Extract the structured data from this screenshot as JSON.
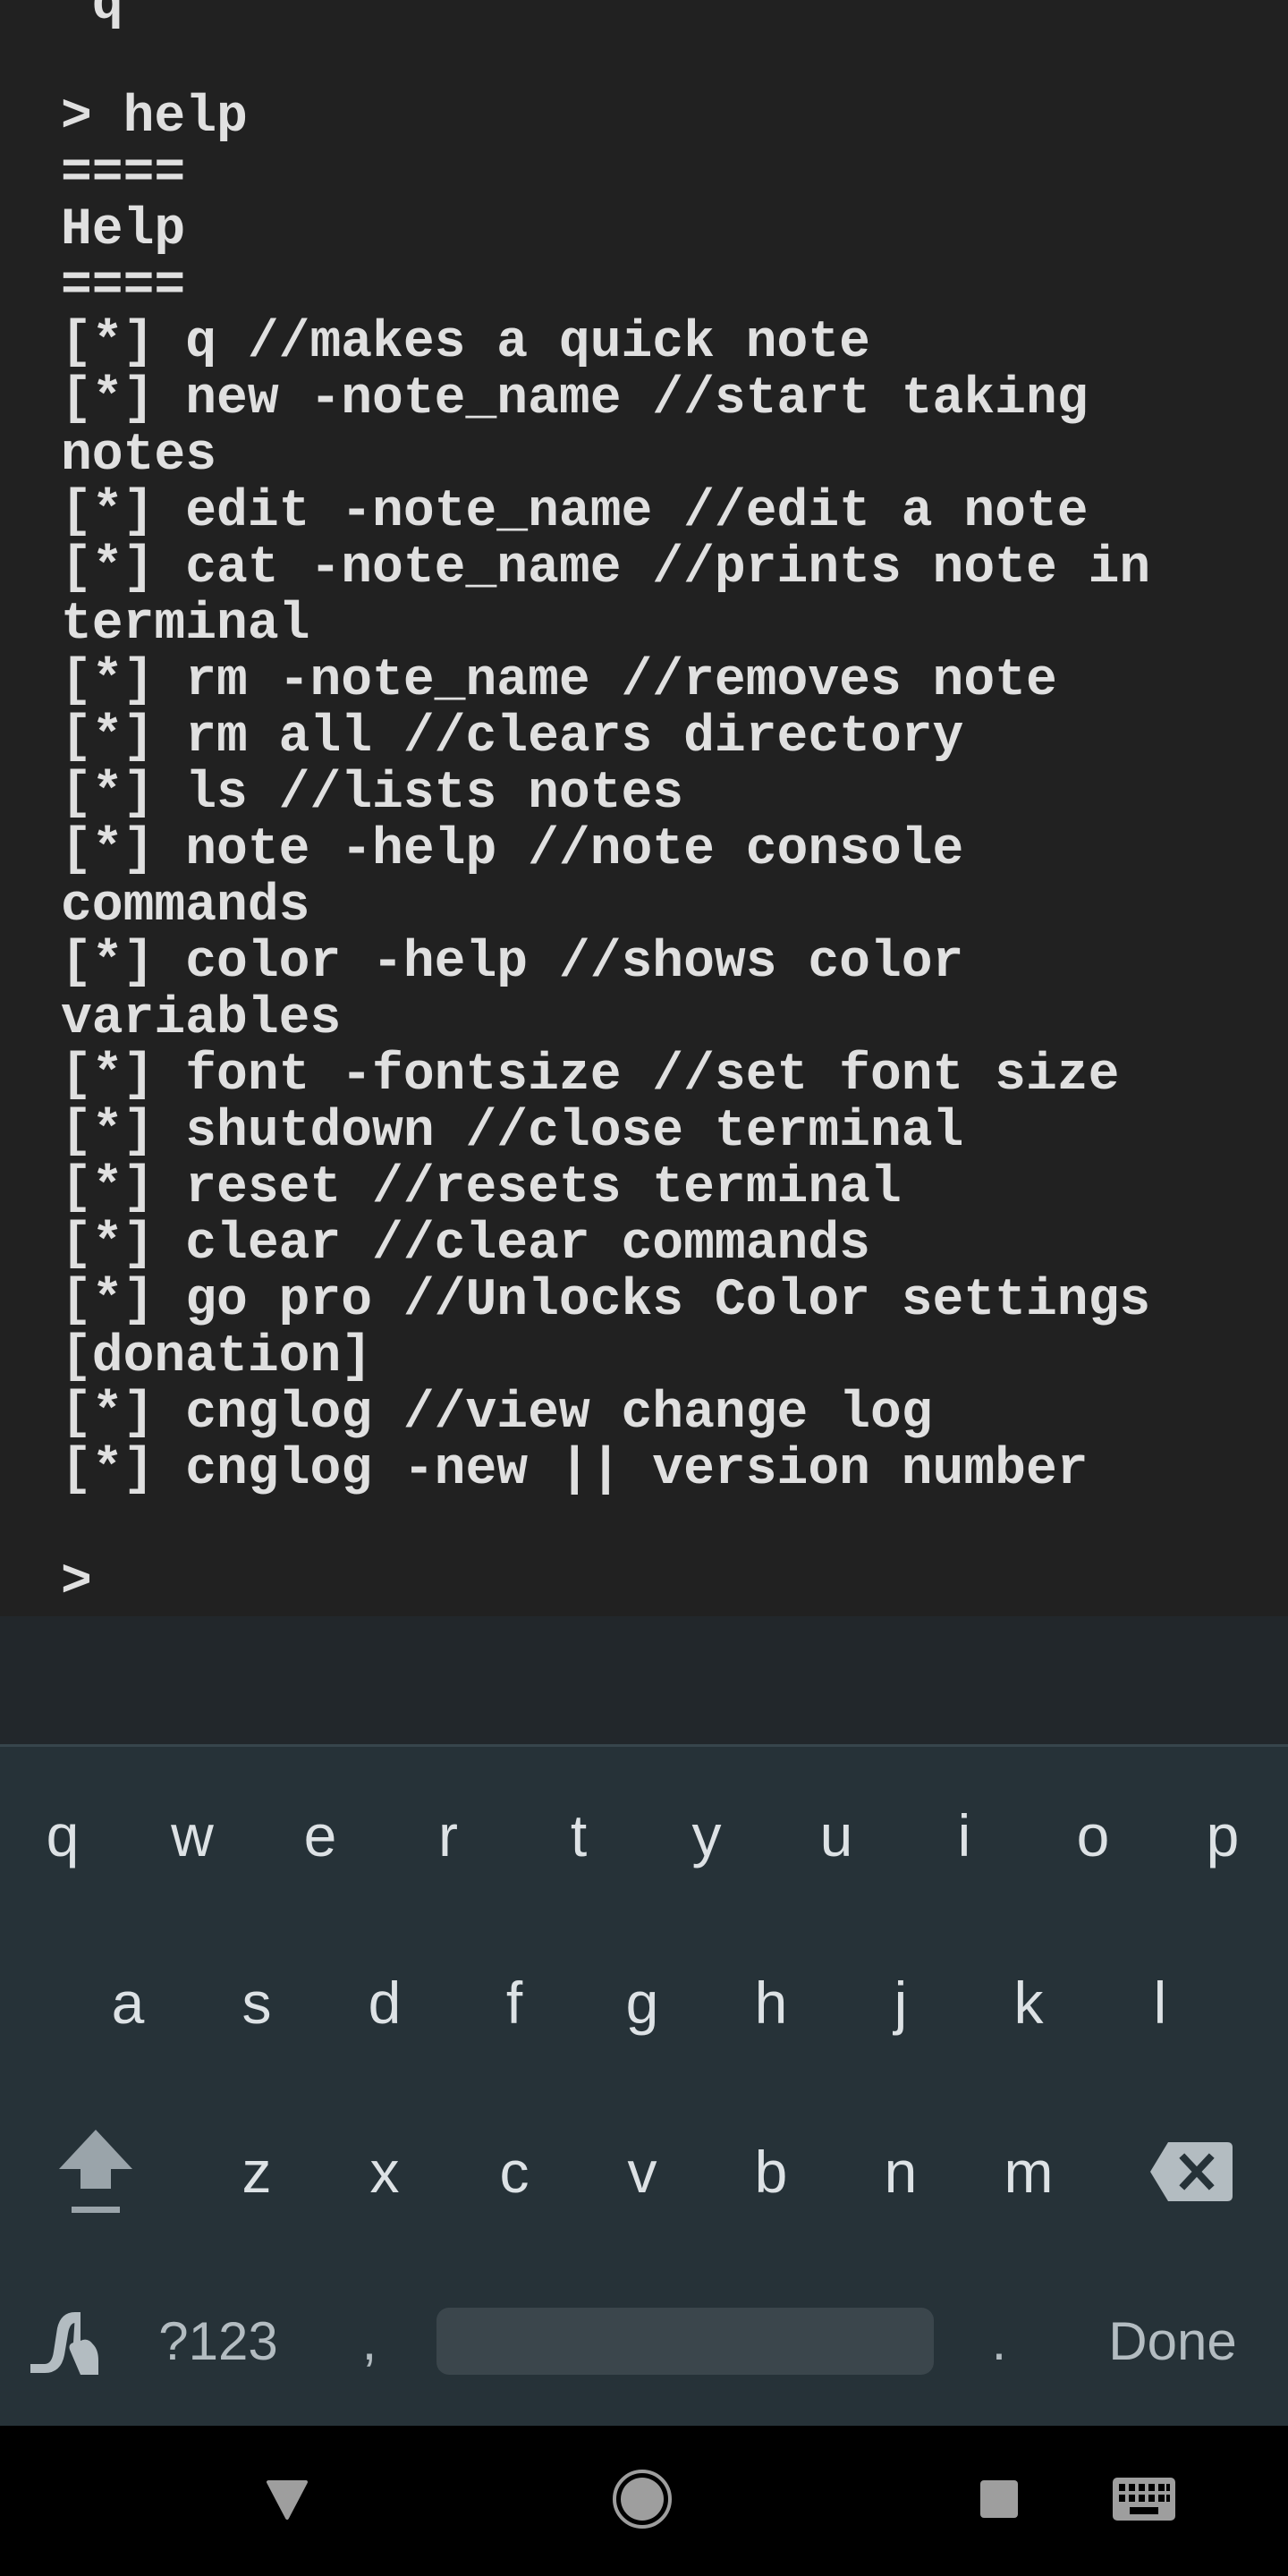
{
  "terminal": {
    "lines": [
      " q",
      "",
      "> help",
      "====",
      "Help",
      "====",
      "[*] q //makes a quick note",
      "[*] new -note_name //start taking",
      "notes",
      "[*] edit -note_name //edit a note",
      "[*] cat -note_name //prints note in",
      "terminal",
      "[*] rm -note_name //removes note",
      "[*] rm all //clears directory",
      "[*] ls //lists notes",
      "[*] note -help //note console",
      "commands",
      "[*] color -help //shows color",
      "variables",
      "[*] font -fontsize //set font size",
      "[*] shutdown //close terminal",
      "[*] reset //resets terminal",
      "[*] clear //clear commands",
      "[*] go pro //Unlocks Color settings",
      "[donation]",
      "[*] cnglog //view change log",
      "[*] cnglog -new || version number",
      "",
      ">"
    ],
    "prompt": ">",
    "colors": {
      "background": "#212121",
      "text": "#e0e0e0"
    }
  },
  "keyboard": {
    "row1": [
      "q",
      "w",
      "e",
      "r",
      "t",
      "y",
      "u",
      "i",
      "o",
      "p"
    ],
    "row2": [
      "a",
      "s",
      "d",
      "f",
      "g",
      "h",
      "j",
      "k",
      "l"
    ],
    "row3": [
      "z",
      "x",
      "c",
      "v",
      "b",
      "n",
      "m"
    ],
    "row4": {
      "gesture_icon": "gesture-typing-icon",
      "symbols_label": "?123",
      "comma_label": ",",
      "period_label": ".",
      "action_label": "Done"
    },
    "shift_icon": "shift-arrow-icon",
    "backspace_icon": "backspace-icon",
    "colors": {
      "background": "#263238",
      "suggestion_strip": "#22272b",
      "key_text": "#dde2e5",
      "func_text": "#b3bcc1",
      "space": "#3b464c"
    }
  },
  "nav_bar": {
    "buttons": [
      {
        "name": "back",
        "icon": "back-triangle-icon"
      },
      {
        "name": "home",
        "icon": "home-circle-icon"
      },
      {
        "name": "recents",
        "icon": "recents-square-icon"
      },
      {
        "name": "keyboard-switcher",
        "icon": "keyboard-icon"
      }
    ]
  }
}
